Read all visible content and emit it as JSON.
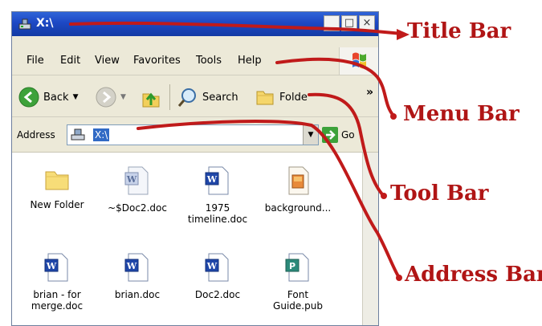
{
  "window": {
    "title": "X:\\",
    "buttons": {
      "minimize": "_",
      "maximize": "□",
      "close": "×"
    }
  },
  "menu": {
    "items": [
      "File",
      "Edit",
      "View",
      "Favorites",
      "Tools",
      "Help"
    ]
  },
  "toolbar": {
    "back_label": "Back",
    "search_label": "Search",
    "folders_label": "Folde",
    "more": "»"
  },
  "address": {
    "label": "Address",
    "value": "X:\\",
    "go_label": "Go"
  },
  "files": [
    {
      "name": "New Folder",
      "icon": "folder-icon"
    },
    {
      "name": "~$Doc2.doc",
      "icon": "word-doc-icon"
    },
    {
      "name": "1975 timeline.doc",
      "icon": "word-doc-icon"
    },
    {
      "name": "background...",
      "icon": "image-file-icon"
    },
    {
      "name": "brian - for merge.doc",
      "icon": "word-doc-icon"
    },
    {
      "name": "brian.doc",
      "icon": "word-doc-icon"
    },
    {
      "name": "Doc2.doc",
      "icon": "word-doc-icon"
    },
    {
      "name": "Font Guide.pub",
      "icon": "publisher-file-icon"
    }
  ],
  "annotations": {
    "title_bar": "Title Bar",
    "menu_bar": "Menu Bar",
    "tool_bar": "Tool Bar",
    "address_bar": "Address Bar",
    "color": "#b01515"
  },
  "colors": {
    "titlebar": "#1d48c4",
    "chrome": "#ece9d8",
    "selection": "#316ac5"
  }
}
